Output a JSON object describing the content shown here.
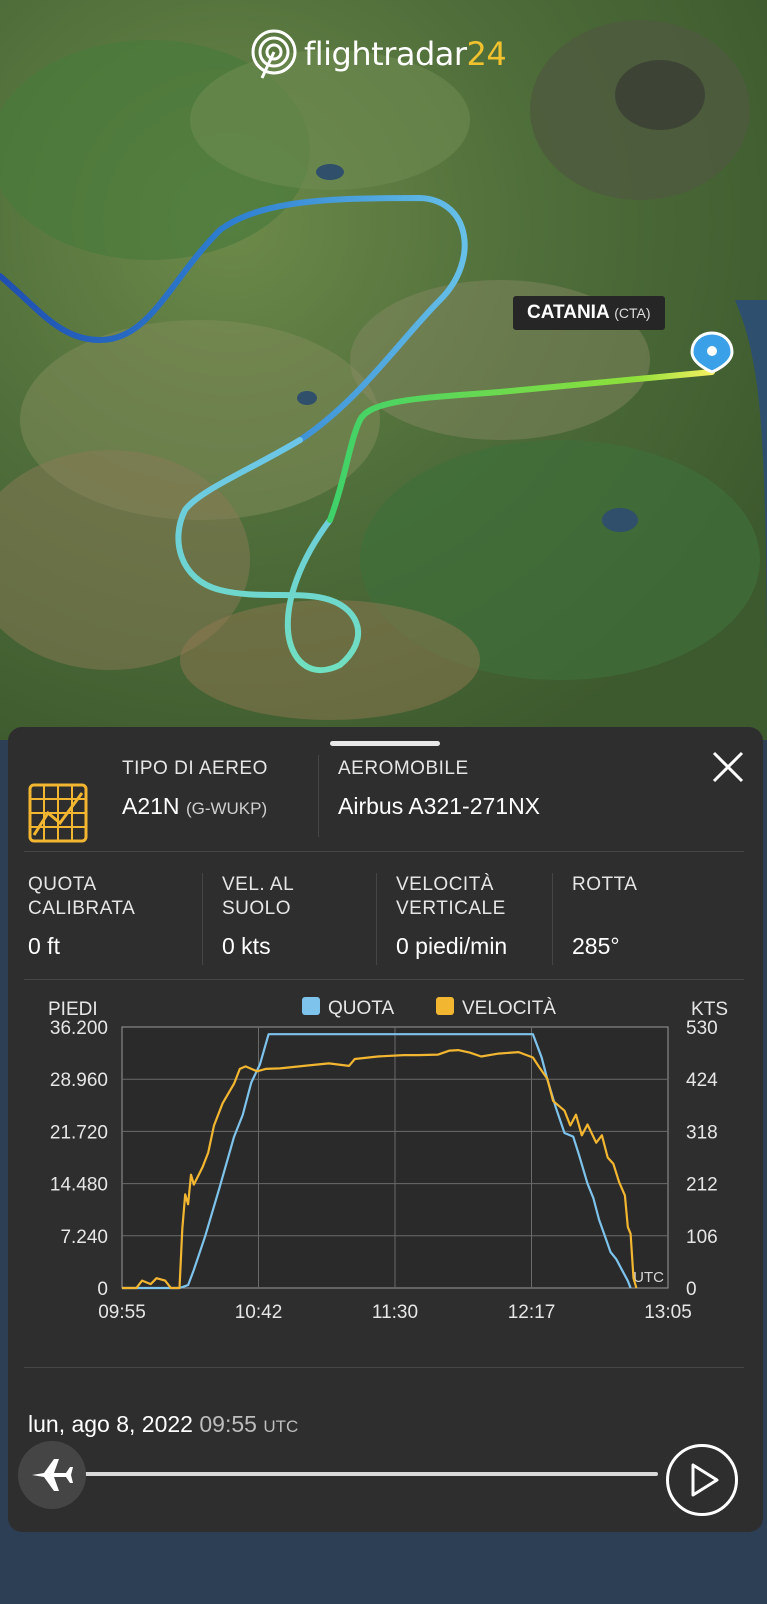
{
  "app": {
    "logo_text": "flightradar",
    "logo_number": "24"
  },
  "map": {
    "airport_name": "CATANIA",
    "airport_code": "(CTA)"
  },
  "panel": {
    "aircraft_type_label": "TIPO DI AEREO",
    "aircraft_type_value": "A21N",
    "registration": "(G-WUKP)",
    "aircraft_label": "AEROMOBILE",
    "aircraft_value": "Airbus A321-271NX",
    "stats": [
      {
        "label_line1": "QUOTA",
        "label_line2": "CALIBRATA",
        "value": "0 ft"
      },
      {
        "label_line1": "VEL. AL",
        "label_line2": "SUOLO",
        "value": "0 kts"
      },
      {
        "label_line1": "VELOCITÀ",
        "label_line2": "VERTICALE",
        "value": "0 piedi/min"
      },
      {
        "label_line1": "ROTTA",
        "label_line2": "",
        "value": "285°"
      }
    ]
  },
  "chart_data": {
    "type": "line",
    "left_axis_label": "PIEDI",
    "right_axis_label": "KTS",
    "y_ticks_left": [
      "36.200",
      "28.960",
      "21.720",
      "14.480",
      "7.240",
      "0"
    ],
    "y_ticks_right": [
      "530",
      "424",
      "318",
      "212",
      "106",
      "0"
    ],
    "x_ticks": [
      "09:55",
      "10:42",
      "11:30",
      "12:17",
      "13:05"
    ],
    "x_range_minutes": [
      595,
      785
    ],
    "ylim_left": [
      0,
      36200
    ],
    "ylim_right": [
      0,
      530
    ],
    "corner_label": "UTC",
    "colors": {
      "altitude": "#7ec3ec",
      "speed": "#f2b631"
    },
    "series": [
      {
        "name": "QUOTA",
        "axis": "left",
        "points": [
          [
            595,
            0
          ],
          [
            615,
            0
          ],
          [
            618,
            400
          ],
          [
            620,
            2500
          ],
          [
            624,
            7240
          ],
          [
            629,
            14000
          ],
          [
            634,
            21000
          ],
          [
            637,
            24000
          ],
          [
            640,
            28500
          ],
          [
            643,
            31000
          ],
          [
            646,
            35200
          ],
          [
            738,
            35200
          ],
          [
            741,
            32000
          ],
          [
            743,
            28960
          ],
          [
            746,
            25000
          ],
          [
            749,
            21500
          ],
          [
            752,
            21000
          ],
          [
            754,
            18500
          ],
          [
            757,
            14480
          ],
          [
            759,
            12500
          ],
          [
            761,
            9500
          ],
          [
            763,
            7240
          ],
          [
            765,
            5000
          ],
          [
            767,
            4000
          ],
          [
            769,
            2500
          ],
          [
            771,
            1000
          ],
          [
            772,
            0
          ]
        ]
      },
      {
        "name": "VELOCITÀ",
        "axis": "right",
        "points": [
          [
            595,
            0
          ],
          [
            600,
            0
          ],
          [
            602,
            15
          ],
          [
            605,
            8
          ],
          [
            607,
            20
          ],
          [
            610,
            15
          ],
          [
            612,
            0
          ],
          [
            615,
            0
          ],
          [
            616,
            120
          ],
          [
            617,
            190
          ],
          [
            618,
            170
          ],
          [
            619,
            230
          ],
          [
            620,
            210
          ],
          [
            623,
            245
          ],
          [
            625,
            275
          ],
          [
            627,
            330
          ],
          [
            630,
            375
          ],
          [
            634,
            415
          ],
          [
            636,
            445
          ],
          [
            638,
            450
          ],
          [
            642,
            440
          ],
          [
            645,
            445
          ],
          [
            650,
            446
          ],
          [
            660,
            452
          ],
          [
            667,
            456
          ],
          [
            674,
            451
          ],
          [
            676,
            465
          ],
          [
            684,
            470
          ],
          [
            693,
            473
          ],
          [
            698,
            473
          ],
          [
            705,
            474
          ],
          [
            709,
            482
          ],
          [
            712,
            483
          ],
          [
            716,
            478
          ],
          [
            720,
            470
          ],
          [
            726,
            476
          ],
          [
            733,
            479
          ],
          [
            738,
            468
          ],
          [
            740,
            450
          ],
          [
            743,
            425
          ],
          [
            745,
            380
          ],
          [
            749,
            360
          ],
          [
            751,
            330
          ],
          [
            753,
            352
          ],
          [
            755,
            310
          ],
          [
            757,
            332
          ],
          [
            760,
            295
          ],
          [
            762,
            310
          ],
          [
            764,
            265
          ],
          [
            766,
            252
          ],
          [
            768,
            215
          ],
          [
            770,
            188
          ],
          [
            771,
            124
          ],
          [
            772,
            110
          ],
          [
            773,
            20
          ],
          [
            774,
            0
          ]
        ]
      }
    ]
  },
  "timeline": {
    "date": "lun, ago 8, 2022",
    "time": "09:55",
    "tz": "UTC"
  }
}
